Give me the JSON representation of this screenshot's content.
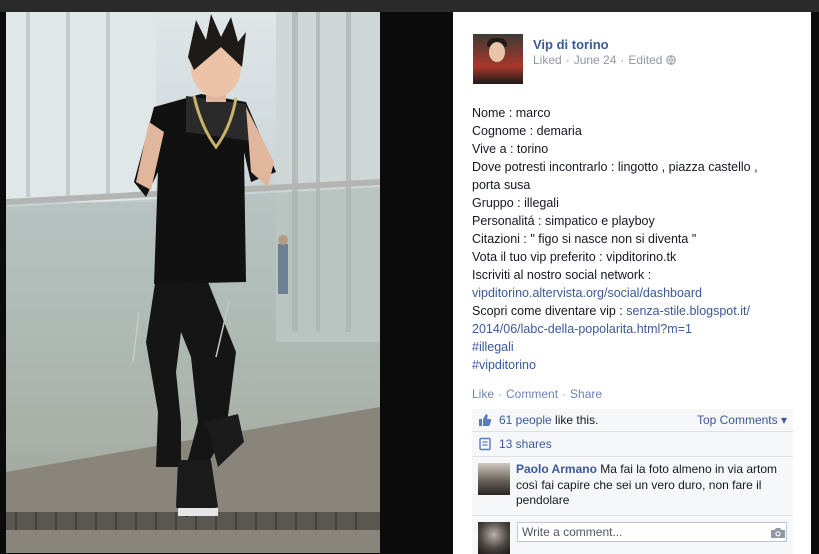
{
  "post": {
    "page_name": "Vip di torino",
    "liked": "Liked",
    "date": "June 24",
    "edited": "Edited",
    "lines": [
      "Nome : marco",
      "Cognome : demaria",
      "Vive a : torino",
      "Dove potresti incontrarlo : lingotto , piazza castello ,",
      "porta susa",
      "Gruppo : illegali",
      "Personalitá : simpatico e playboy",
      "Citazioni : \" figo si nasce non si diventa \"",
      "Vota il tuo vip preferito : vipditorino.tk",
      "Iscriviti al nostro social network :"
    ],
    "social_link": "vipditorino.altervista.org/social/dashboard",
    "diventare_prefix": "Scopri come diventare vip : ",
    "diventare_link_1": "senza-stile.blogspot.it/",
    "diventare_link_2": "2014/06/labc-della-popolarita.html?m=1",
    "hashtags": [
      "#illegali",
      "#vipditorino"
    ]
  },
  "actions": {
    "like": "Like",
    "comment": "Comment",
    "share": "Share"
  },
  "ufi": {
    "likes_count": "61 people",
    "likes_suffix": " like this.",
    "top_comments": "Top Comments ▾",
    "shares": "13 shares"
  },
  "comment": {
    "author": "Paolo Armano",
    "text": "Ma fai la foto almeno in via artom così fai capire che sei un vero duro, non fare il pendolare"
  },
  "composer": {
    "placeholder": "Write a comment..."
  },
  "colors": {
    "link": "#3b5998",
    "meta": "#9197a3",
    "ufi_bg": "#f6f7f8"
  }
}
